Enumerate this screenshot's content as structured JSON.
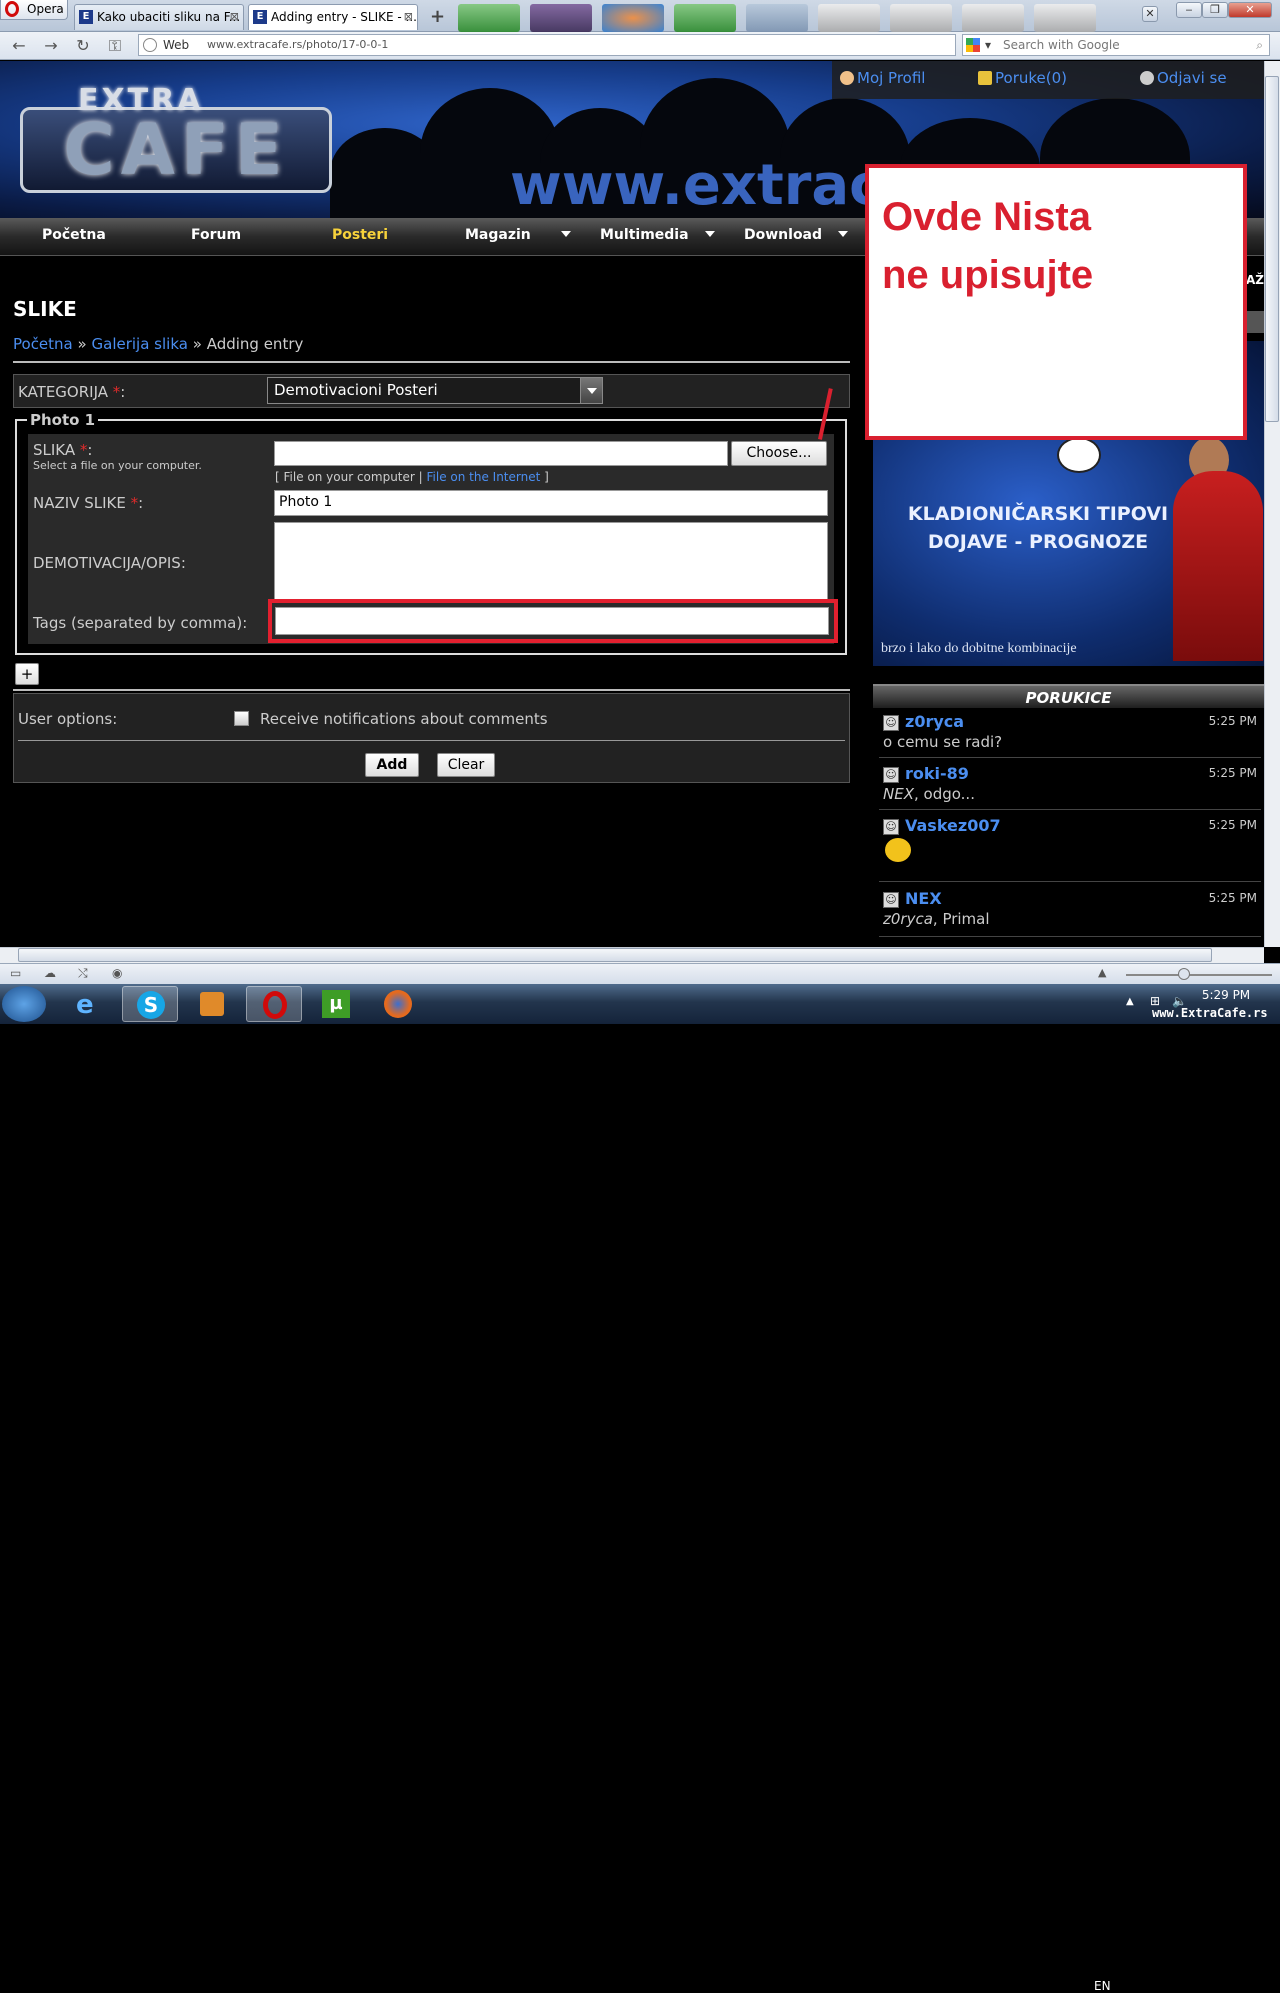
{
  "browser": {
    "menu_label": "Opera",
    "tabs": [
      {
        "label": "Kako ubaciti sliku na F...",
        "favicon": "E"
      },
      {
        "label": "Adding entry - SLIKE - ...",
        "favicon": "E"
      }
    ],
    "address": {
      "scheme_label": "Web",
      "url": "www.extracafe.rs/photo/17-0-0-1"
    },
    "search_placeholder": "Search with Google"
  },
  "site": {
    "logo_top": "EXTRA",
    "logo_main": "CAFE",
    "banner_url": "www.extrac",
    "user_menu": {
      "profile": "Moj Profil",
      "messages": "Poruke(0)",
      "logout": "Odjavi se"
    },
    "nav": [
      "Početna",
      "Forum",
      "Posteri",
      "Magazin",
      "Multimedia",
      "Download"
    ],
    "nav_current": "Posteri"
  },
  "content": {
    "title": "SLIKE",
    "breadcrumb": {
      "home": "Početna",
      "sep": "»",
      "gallery": "Galerija slika",
      "current": "Adding entry"
    },
    "category_label": "KATEGORIJA",
    "category_value": "Demotivacioni   Posteri",
    "required_mark": "*",
    "colon": ":",
    "photo_legend": "Photo 1",
    "slika_label": "SLIKA",
    "slika_hint": "Select a file on your computer.",
    "choose_button": "Choose...",
    "file_opt_local": "File on your computer",
    "file_opt_internet": "File on the Internet",
    "naziv_label": "NAZIV SLIKE",
    "naziv_value": "Photo 1",
    "opis_label": "DEMOTIVACIJA/OPIS:",
    "tags_label": "Tags (separated by comma):",
    "add_more": "+",
    "user_options_label": "User options:",
    "notify_label": "Receive notifications about comments",
    "add_button": "Add",
    "clear_button": "Clear"
  },
  "annotation": {
    "line1": "Ovde Nista",
    "line2": "ne upisujte",
    "color": "#d9202f"
  },
  "sidebar": {
    "edge_text": "AŽ",
    "ad": {
      "line1": "KLADIONIČARSKI TIPOVI",
      "line2": "DOJAVE - PROGNOZE",
      "sub": "brzo i lako do dobitne kombinacije"
    },
    "poruke_title": "PORUKICE",
    "messages": [
      {
        "user": "z0ryca",
        "time": "5:25 PM",
        "text": "o cemu se radi?"
      },
      {
        "user": "roki-89",
        "time": "5:25 PM",
        "text_em": "NEX",
        "text": ", odgo..."
      },
      {
        "user": "Vaskez007",
        "time": "5:25 PM",
        "text": ""
      },
      {
        "user": "NEX",
        "time": "5:25 PM",
        "text_em": "z0ryca",
        "text": ", Primal"
      }
    ]
  },
  "taskbar": {
    "lang": "EN",
    "time": "5:29 PM"
  },
  "watermark": "www.ExtraCafe.rs"
}
